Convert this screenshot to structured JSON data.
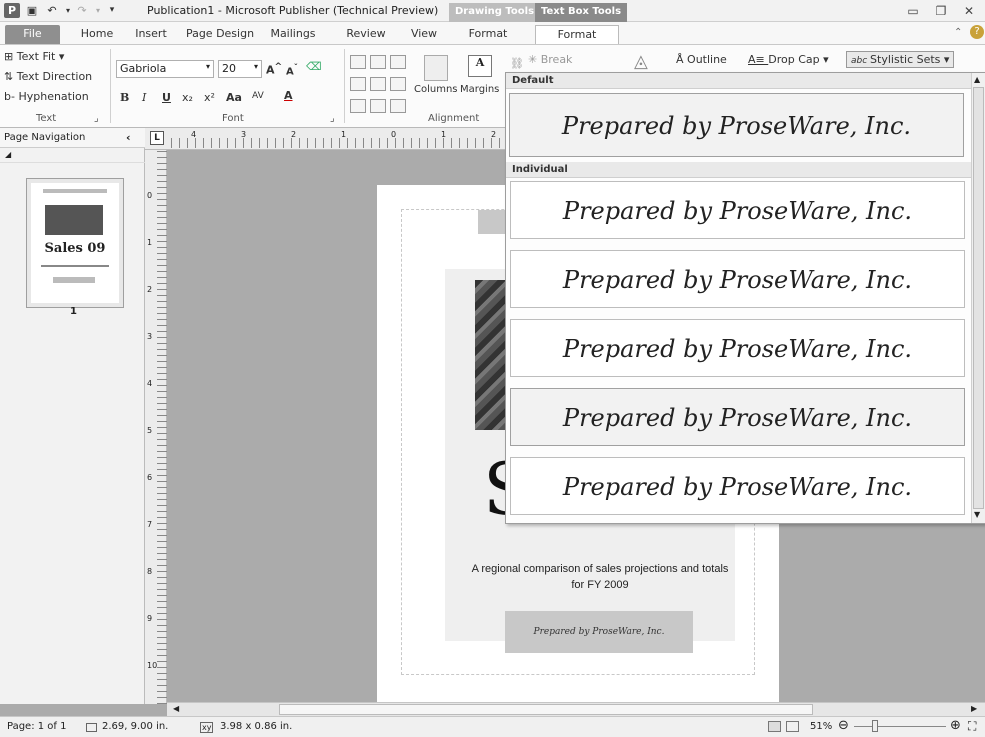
{
  "app": {
    "title": "Publication1 - Microsoft Publisher (Technical Preview)",
    "context_tabs": [
      {
        "label": "Drawing Tools",
        "color": "#c0c0c0"
      },
      {
        "label": "Text Box Tools",
        "color": "#8a8a8a"
      }
    ]
  },
  "tabs": [
    "File",
    "Home",
    "Insert",
    "Page Design",
    "Mailings",
    "Review",
    "View",
    "Format",
    "Format"
  ],
  "ribbon": {
    "text_group": {
      "text_fit": "Text Fit",
      "text_direction": "Text Direction",
      "hyphenation": "Hyphenation",
      "label": "Text"
    },
    "font_group": {
      "font_name": "Gabriola",
      "font_size": "20",
      "label": "Font",
      "buttons": [
        "B",
        "I",
        "U",
        "x₂",
        "x²",
        "Aa",
        "AV",
        "A"
      ]
    },
    "alignment_group": {
      "columns": "Columns",
      "margins": "Margins",
      "label": "Alignment"
    },
    "linking": {
      "break": "Break"
    },
    "typography": {
      "outline": "Outline",
      "drop_cap": "Drop Cap",
      "stylistic_sets": "Stylistic Sets"
    }
  },
  "nav": {
    "title": "Page Navigation",
    "page_number": "1",
    "thumb_title": "Sales 09"
  },
  "document": {
    "title_fragment": "Sales 09",
    "subtitle": "A regional comparison of sales projections and totals for FY 2009",
    "prepared_box": "Prepared by ProseWare, Inc."
  },
  "gallery": {
    "default_header": "Default",
    "individual_header": "Individual",
    "default_item": "Prepared by ProseWare, Inc.",
    "items": [
      "Prepared by ProseWare, Inc.",
      "Prepared by ProseWare, Inc.",
      "Prepared by ProseWare, Inc.",
      "Prepared by ProseWare, Inc.",
      "Prepared by ProseWare, Inc."
    ]
  },
  "status": {
    "page": "Page: 1 of 1",
    "position": "2.69, 9.00 in.",
    "size": "3.98 x 0.86 in.",
    "zoom": "51%"
  },
  "ruler_h": [
    "4",
    "3",
    "2",
    "1",
    "0",
    "1",
    "2"
  ],
  "ruler_v": [
    "0",
    "1",
    "2",
    "3",
    "4",
    "5",
    "6",
    "7",
    "8",
    "9",
    "10"
  ]
}
